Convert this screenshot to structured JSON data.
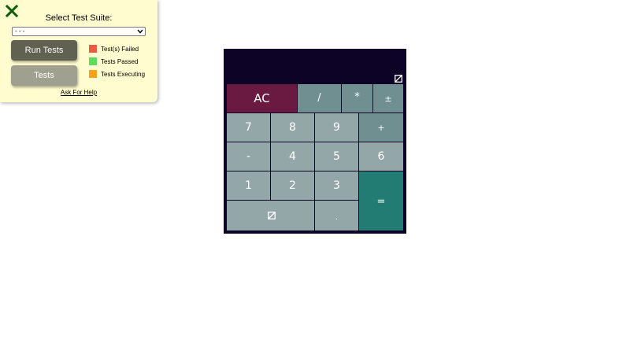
{
  "test_panel": {
    "title": "Select Test Suite:",
    "suite_select_value": "- - -",
    "run_button": "Run Tests",
    "tests_button": "Tests",
    "legend": [
      {
        "label": "Test(s) Failed",
        "color": "#ef5a43"
      },
      {
        "label": "Tests Passed",
        "color": "#5fdc5b"
      },
      {
        "label": "Tests Executing",
        "color": "#f7a21b"
      }
    ],
    "help_link": "Ask For Help"
  },
  "calculator": {
    "display_value": "",
    "keys": {
      "clear": "AC",
      "divide": "/",
      "multiply": "*",
      "plus_minus": "±",
      "seven": "7",
      "eight": "8",
      "nine": "9",
      "add": "+",
      "subtract": "-",
      "four": "4",
      "five": "5",
      "six": "6",
      "one": "1",
      "two": "2",
      "three": "3",
      "equals": "=",
      "decimal": "."
    },
    "colors": {
      "frame": "#0c0326",
      "number_key": "#93a7a8",
      "operator_key": "#6f8f91",
      "clear_key": "#6a1a40",
      "equals_key": "#227c74"
    }
  }
}
